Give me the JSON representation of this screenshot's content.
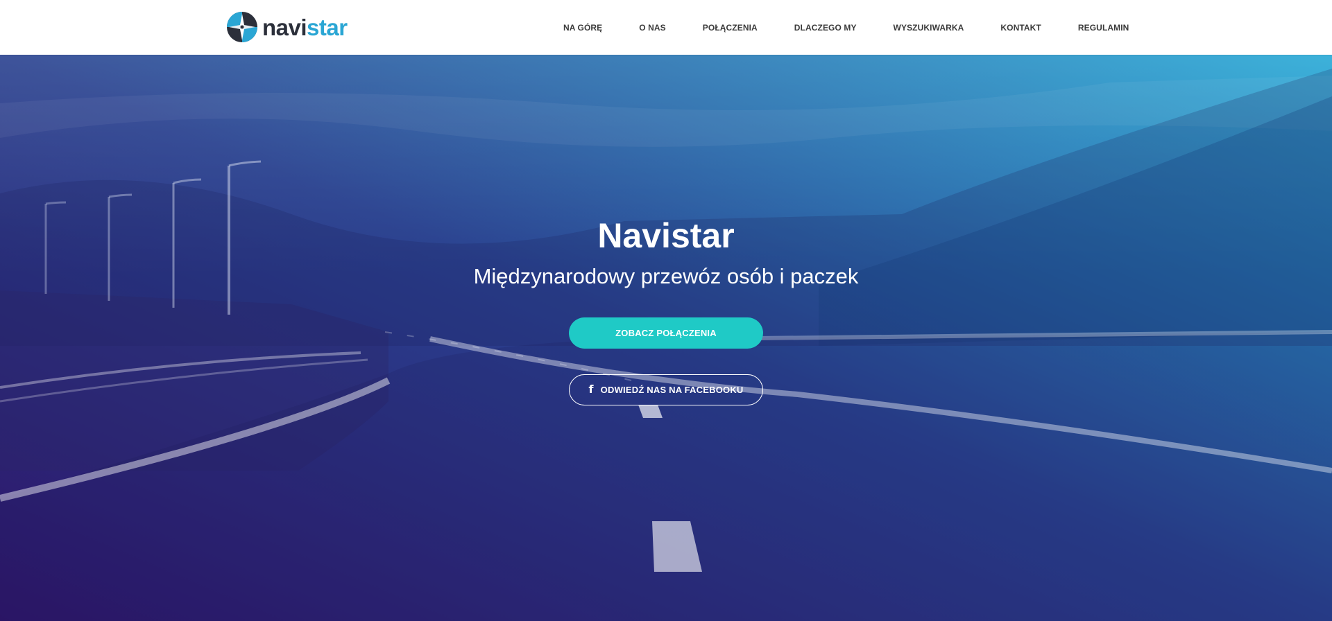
{
  "header": {
    "logo": {
      "part1": "navi",
      "part2": "star",
      "icon": "compass-icon"
    },
    "nav": [
      {
        "label": "NA GÓRĘ"
      },
      {
        "label": "O NAS"
      },
      {
        "label": "POŁĄCZENIA"
      },
      {
        "label": "DLACZEGO MY"
      },
      {
        "label": "WYSZUKIWARKA"
      },
      {
        "label": "KONTAKT"
      },
      {
        "label": "REGULAMIN"
      }
    ]
  },
  "hero": {
    "title": "Navistar",
    "subtitle": "Międzynarodowy przewóz osób i paczek",
    "primary_button": "ZOBACZ POŁĄCZENIA",
    "secondary_button": "ODWIEDŹ NAS NA FACEBOOKU",
    "secondary_icon": "facebook-icon"
  },
  "colors": {
    "accent": "#1fcac6",
    "logo_dark": "#2b2f3a",
    "logo_blue": "#2aa6d4",
    "hero_gradient_start": "#2e1468",
    "hero_gradient_end": "#27a9d6"
  }
}
